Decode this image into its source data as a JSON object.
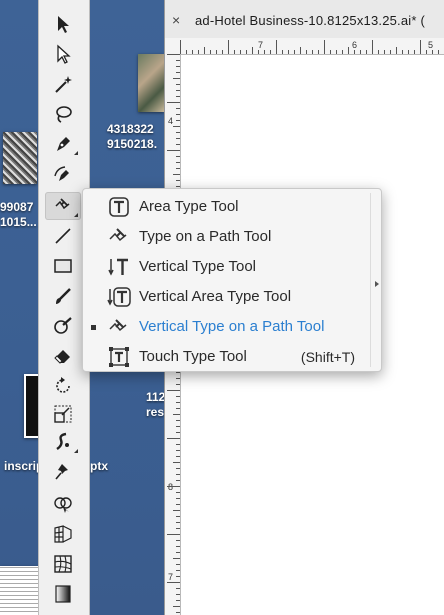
{
  "window": {
    "close_glyph": "×",
    "tab_title": "ad-Hotel Business-10.8125x13.25.ai* ("
  },
  "rulers": {
    "h_labels": [
      "7",
      "6",
      "5"
    ],
    "v_labels": [
      "4",
      "8",
      "7"
    ]
  },
  "desktop": {
    "labels": [
      "4318322",
      "9150218.",
      "99087",
      "1015...",
      "112",
      "res",
      "inscrip",
      "ptx"
    ]
  },
  "toolbar": {
    "tools": [
      {
        "name": "selection-tool",
        "icon": "arrow-black-icon"
      },
      {
        "name": "direct-selection-tool",
        "icon": "arrow-white-icon"
      },
      {
        "name": "magic-wand-tool",
        "icon": "magic-wand-icon"
      },
      {
        "name": "lasso-tool",
        "icon": "lasso-icon"
      },
      {
        "name": "pen-tool",
        "icon": "pen-icon"
      },
      {
        "name": "curvature-tool",
        "icon": "curvature-pen-icon"
      },
      {
        "name": "type-on-path-tool",
        "icon": "type-on-path-icon",
        "active": true
      },
      {
        "name": "line-segment-tool",
        "icon": "line-icon"
      },
      {
        "name": "rectangle-tool",
        "icon": "rectangle-icon"
      },
      {
        "name": "paintbrush-tool",
        "icon": "paintbrush-icon"
      },
      {
        "name": "blob-brush-tool",
        "icon": "blob-brush-icon"
      },
      {
        "name": "eraser-tool",
        "icon": "eraser-icon"
      },
      {
        "name": "rotate-tool",
        "icon": "rotate-icon"
      },
      {
        "name": "scale-tool",
        "icon": "scale-icon"
      },
      {
        "name": "warp-tool",
        "icon": "warp-icon"
      },
      {
        "name": "puppet-warp-tool",
        "icon": "pin-icon"
      },
      {
        "name": "shape-builder-tool",
        "icon": "shape-builder-icon"
      },
      {
        "name": "perspective-grid-tool",
        "icon": "perspective-grid-icon"
      },
      {
        "name": "mesh-tool",
        "icon": "mesh-icon"
      },
      {
        "name": "gradient-tool",
        "icon": "gradient-icon"
      }
    ]
  },
  "flyout": {
    "items": [
      {
        "label": "Area Type Tool",
        "shortcut": "",
        "icon": "area-type-icon",
        "selected": false
      },
      {
        "label": "Type on a Path Tool",
        "shortcut": "",
        "icon": "type-on-path-icon",
        "selected": false
      },
      {
        "label": "Vertical Type Tool",
        "shortcut": "",
        "icon": "vertical-type-icon",
        "selected": false
      },
      {
        "label": "Vertical Area Type Tool",
        "shortcut": "",
        "icon": "vertical-area-type-icon",
        "selected": false
      },
      {
        "label": "Vertical Type on a Path Tool",
        "shortcut": "",
        "icon": "vertical-type-on-path-icon",
        "selected": true
      },
      {
        "label": "Touch Type Tool",
        "shortcut": "(Shift+T)",
        "icon": "touch-type-icon",
        "selected": false
      }
    ],
    "colors": {
      "selected_text": "#2b7fd0"
    }
  }
}
